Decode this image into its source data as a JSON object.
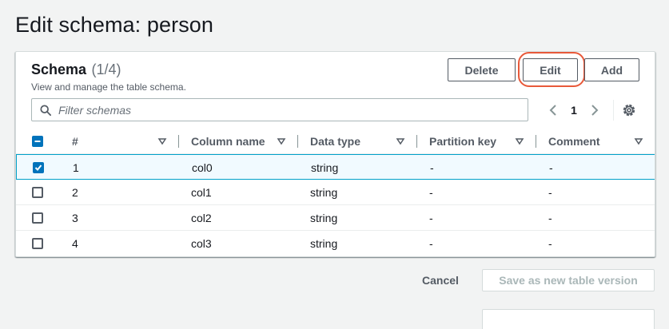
{
  "page": {
    "title": "Edit schema: person"
  },
  "panel": {
    "title": "Schema",
    "count": "(1/4)",
    "description": "View and manage the table schema.",
    "buttons": {
      "delete": "Delete",
      "edit": "Edit",
      "add": "Add"
    },
    "filter": {
      "placeholder": "Filter schemas",
      "value": ""
    },
    "pagination": {
      "current_page": "1"
    }
  },
  "table": {
    "headers": [
      "#",
      "Column name",
      "Data type",
      "Partition key",
      "Comment"
    ],
    "rows": [
      {
        "num": "1",
        "column_name": "col0",
        "data_type": "string",
        "partition_key": "-",
        "comment": "-",
        "selected": true
      },
      {
        "num": "2",
        "column_name": "col1",
        "data_type": "string",
        "partition_key": "-",
        "comment": "-",
        "selected": false
      },
      {
        "num": "3",
        "column_name": "col2",
        "data_type": "string",
        "partition_key": "-",
        "comment": "-",
        "selected": false
      },
      {
        "num": "4",
        "column_name": "col3",
        "data_type": "string",
        "partition_key": "-",
        "comment": "-",
        "selected": false
      }
    ]
  },
  "footer": {
    "cancel": "Cancel",
    "save": "Save as new table version"
  },
  "colors": {
    "accent": "#0073bb",
    "highlight_ring": "#e8593a",
    "selected_row_bg": "#f1faff",
    "selected_row_border": "#00a1c9"
  },
  "icons": [
    "search-icon",
    "chevron-left-icon",
    "chevron-right-icon",
    "gear-icon",
    "sort-caret-icon",
    "checkbox-icon"
  ]
}
